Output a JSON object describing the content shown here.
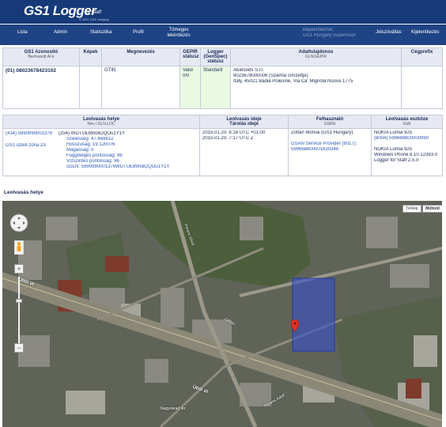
{
  "header": {
    "logo": "GS1 Logger",
    "logo_sub": "for Staff",
    "copyright": "© 2011 GS1 Hungary"
  },
  "nav": {
    "items": [
      "Lista",
      "Admin",
      "Statisztika",
      "Profil",
      "Tömeges lekérdezés"
    ],
    "user_line1": "Bejelentkezve:",
    "user_line2": "GS1 Hungary Supervisor",
    "change_password": "Jelszóváltás",
    "logout": "Kijelentkezés"
  },
  "product_table": {
    "headers": [
      {
        "title": "GS1 Azonosító",
        "sub": "Beolvasott AI-k"
      },
      {
        "title": "Képek",
        "sub": ""
      },
      {
        "title": "Megnevezés",
        "sub": ""
      },
      {
        "title": "GEPIR státusz",
        "sub": ""
      },
      {
        "title": "Logger (GenSpec) státusz",
        "sub": ""
      },
      {
        "title": "Adattulajdonos",
        "sub": "GLN/GEPIR"
      },
      {
        "title": "Cégprefix",
        "sub": ""
      }
    ],
    "row": {
      "gs1_id": "(01) 08023678423102",
      "images": "",
      "name": "GTIN",
      "gepir_status": "Valid",
      "gepir_sub": "0/0",
      "logger_status": "Standard",
      "owner_lines": [
        "Abafoods S.r.l.",
        "8023678000006 (Számla címzettje)",
        "Italy, 45021 Badia Polesine, Via Ca' Mignola Nuova 1775"
      ],
      "prefix": ""
    }
  },
  "scan_table": {
    "headers": [
      {
        "title": "Leolvasás helye",
        "sub": "Név / GLN,LOC"
      },
      {
        "title": "Leolvasás ideje",
        "sub": "Tárolás ideje"
      },
      {
        "title": "Felhasználó",
        "sub": "GSRN"
      },
      {
        "title": "Leolvasás eszköze",
        "sub": "GIAI"
      }
    ],
    "row": {
      "loc_gln": "(414) 5990990001376",
      "loc_name": "GS1 üzleti zóna 23.",
      "loc_details": [
        "(254) WDTUE89IoB2QOu1Y1Y",
        "Szélesség: 47.469812",
        "Hosszúság: 19.120076",
        "Magasság: 0",
        "Függőleges pontosság: 96",
        "Vízszintes pontosság: 96",
        "sGLN: 5990990001376WDTUE89IoB2QOu1Y1Y"
      ],
      "times": [
        "2015.01.20. 8:18 UTC +01:00",
        "2015.01.20. 7:17 UTC Z"
      ],
      "user_name": "Zoltán Morvai (GS1 Hungary)",
      "user_gsrn": [
        "GSAN Service Provider (8017):",
        "599668800001630346"
      ],
      "device_lines": [
        "NOKIA Lumia 925",
        "(8004) 599668800000990",
        "",
        "NOKIA Lumia 925",
        "Windows Phone 8.10.12393.0",
        "Logger for Staff 2.5.0"
      ]
    }
  },
  "map_section": {
    "title": "Leolvasás helye",
    "map_type_map": "Térkép",
    "map_type_satellite": "Műhold",
    "street_labels": [
      "Üllői út",
      "Üllői út",
      "Ferenc körút",
      "Corvin",
      "Fényes Adolf",
      "Nagyvárad tér"
    ],
    "colors": {
      "marker": "#e0312a",
      "highlight": "#3650c8"
    }
  }
}
